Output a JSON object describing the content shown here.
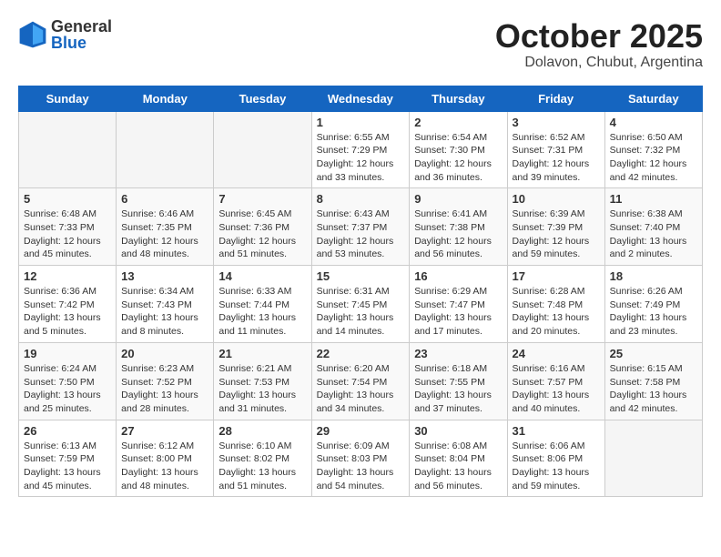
{
  "header": {
    "logo_general": "General",
    "logo_blue": "Blue",
    "month": "October 2025",
    "location": "Dolavon, Chubut, Argentina"
  },
  "weekdays": [
    "Sunday",
    "Monday",
    "Tuesday",
    "Wednesday",
    "Thursday",
    "Friday",
    "Saturday"
  ],
  "weeks": [
    [
      null,
      null,
      null,
      {
        "day": 1,
        "sunrise": "6:55 AM",
        "sunset": "7:29 PM",
        "daylight": "12 hours and 33 minutes."
      },
      {
        "day": 2,
        "sunrise": "6:54 AM",
        "sunset": "7:30 PM",
        "daylight": "12 hours and 36 minutes."
      },
      {
        "day": 3,
        "sunrise": "6:52 AM",
        "sunset": "7:31 PM",
        "daylight": "12 hours and 39 minutes."
      },
      {
        "day": 4,
        "sunrise": "6:50 AM",
        "sunset": "7:32 PM",
        "daylight": "12 hours and 42 minutes."
      }
    ],
    [
      {
        "day": 5,
        "sunrise": "6:48 AM",
        "sunset": "7:33 PM",
        "daylight": "12 hours and 45 minutes."
      },
      {
        "day": 6,
        "sunrise": "6:46 AM",
        "sunset": "7:35 PM",
        "daylight": "12 hours and 48 minutes."
      },
      {
        "day": 7,
        "sunrise": "6:45 AM",
        "sunset": "7:36 PM",
        "daylight": "12 hours and 51 minutes."
      },
      {
        "day": 8,
        "sunrise": "6:43 AM",
        "sunset": "7:37 PM",
        "daylight": "12 hours and 53 minutes."
      },
      {
        "day": 9,
        "sunrise": "6:41 AM",
        "sunset": "7:38 PM",
        "daylight": "12 hours and 56 minutes."
      },
      {
        "day": 10,
        "sunrise": "6:39 AM",
        "sunset": "7:39 PM",
        "daylight": "12 hours and 59 minutes."
      },
      {
        "day": 11,
        "sunrise": "6:38 AM",
        "sunset": "7:40 PM",
        "daylight": "13 hours and 2 minutes."
      }
    ],
    [
      {
        "day": 12,
        "sunrise": "6:36 AM",
        "sunset": "7:42 PM",
        "daylight": "13 hours and 5 minutes."
      },
      {
        "day": 13,
        "sunrise": "6:34 AM",
        "sunset": "7:43 PM",
        "daylight": "13 hours and 8 minutes."
      },
      {
        "day": 14,
        "sunrise": "6:33 AM",
        "sunset": "7:44 PM",
        "daylight": "13 hours and 11 minutes."
      },
      {
        "day": 15,
        "sunrise": "6:31 AM",
        "sunset": "7:45 PM",
        "daylight": "13 hours and 14 minutes."
      },
      {
        "day": 16,
        "sunrise": "6:29 AM",
        "sunset": "7:47 PM",
        "daylight": "13 hours and 17 minutes."
      },
      {
        "day": 17,
        "sunrise": "6:28 AM",
        "sunset": "7:48 PM",
        "daylight": "13 hours and 20 minutes."
      },
      {
        "day": 18,
        "sunrise": "6:26 AM",
        "sunset": "7:49 PM",
        "daylight": "13 hours and 23 minutes."
      }
    ],
    [
      {
        "day": 19,
        "sunrise": "6:24 AM",
        "sunset": "7:50 PM",
        "daylight": "13 hours and 25 minutes."
      },
      {
        "day": 20,
        "sunrise": "6:23 AM",
        "sunset": "7:52 PM",
        "daylight": "13 hours and 28 minutes."
      },
      {
        "day": 21,
        "sunrise": "6:21 AM",
        "sunset": "7:53 PM",
        "daylight": "13 hours and 31 minutes."
      },
      {
        "day": 22,
        "sunrise": "6:20 AM",
        "sunset": "7:54 PM",
        "daylight": "13 hours and 34 minutes."
      },
      {
        "day": 23,
        "sunrise": "6:18 AM",
        "sunset": "7:55 PM",
        "daylight": "13 hours and 37 minutes."
      },
      {
        "day": 24,
        "sunrise": "6:16 AM",
        "sunset": "7:57 PM",
        "daylight": "13 hours and 40 minutes."
      },
      {
        "day": 25,
        "sunrise": "6:15 AM",
        "sunset": "7:58 PM",
        "daylight": "13 hours and 42 minutes."
      }
    ],
    [
      {
        "day": 26,
        "sunrise": "6:13 AM",
        "sunset": "7:59 PM",
        "daylight": "13 hours and 45 minutes."
      },
      {
        "day": 27,
        "sunrise": "6:12 AM",
        "sunset": "8:00 PM",
        "daylight": "13 hours and 48 minutes."
      },
      {
        "day": 28,
        "sunrise": "6:10 AM",
        "sunset": "8:02 PM",
        "daylight": "13 hours and 51 minutes."
      },
      {
        "day": 29,
        "sunrise": "6:09 AM",
        "sunset": "8:03 PM",
        "daylight": "13 hours and 54 minutes."
      },
      {
        "day": 30,
        "sunrise": "6:08 AM",
        "sunset": "8:04 PM",
        "daylight": "13 hours and 56 minutes."
      },
      {
        "day": 31,
        "sunrise": "6:06 AM",
        "sunset": "8:06 PM",
        "daylight": "13 hours and 59 minutes."
      },
      null
    ]
  ]
}
